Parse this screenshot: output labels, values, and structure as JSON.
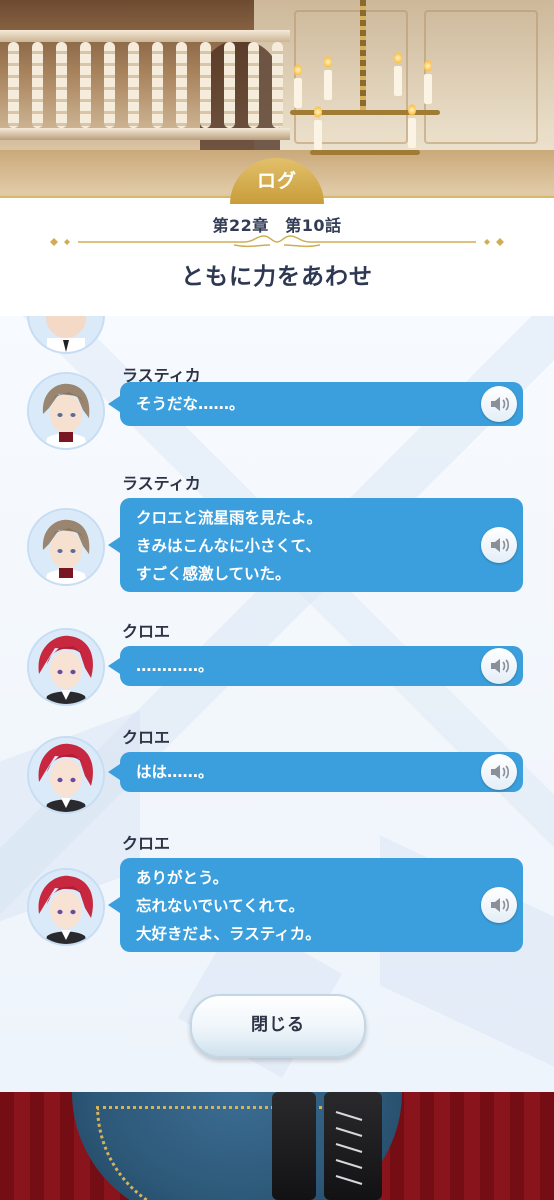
{
  "header": {
    "tab_label": "ログ",
    "chapter": "第22章　第10話",
    "episode_title": "ともに力をあわせ"
  },
  "messages": [
    {
      "speaker": "ラスティカ",
      "lines": [
        "そうだな……。"
      ],
      "avatar": "rustica-portrait",
      "voice_icon": "speaker-icon"
    },
    {
      "speaker": "ラスティカ",
      "lines": [
        "クロエと流星雨を見たよ。",
        "きみはこんなに小さくて、",
        "すごく感激していた。"
      ],
      "avatar": "rustica-portrait",
      "voice_icon": "speaker-icon"
    },
    {
      "speaker": "クロエ",
      "lines": [
        "…………。"
      ],
      "avatar": "chloe-portrait",
      "voice_icon": "speaker-icon"
    },
    {
      "speaker": "クロエ",
      "lines": [
        "はは……。"
      ],
      "avatar": "chloe-portrait",
      "voice_icon": "speaker-icon"
    },
    {
      "speaker": "クロエ",
      "lines": [
        "ありがとう。",
        "忘れないでいてくれて。",
        "大好きだよ、ラスティカ。"
      ],
      "avatar": "chloe-portrait",
      "voice_icon": "speaker-icon"
    }
  ],
  "close_button": {
    "label": "閉じる"
  },
  "colors": {
    "bubble": "#3a9fdc",
    "gold": "#d8b968",
    "text_dark": "#2e3345",
    "rustica_hair": "#9a8670",
    "chloe_hair": "#c8283f"
  }
}
